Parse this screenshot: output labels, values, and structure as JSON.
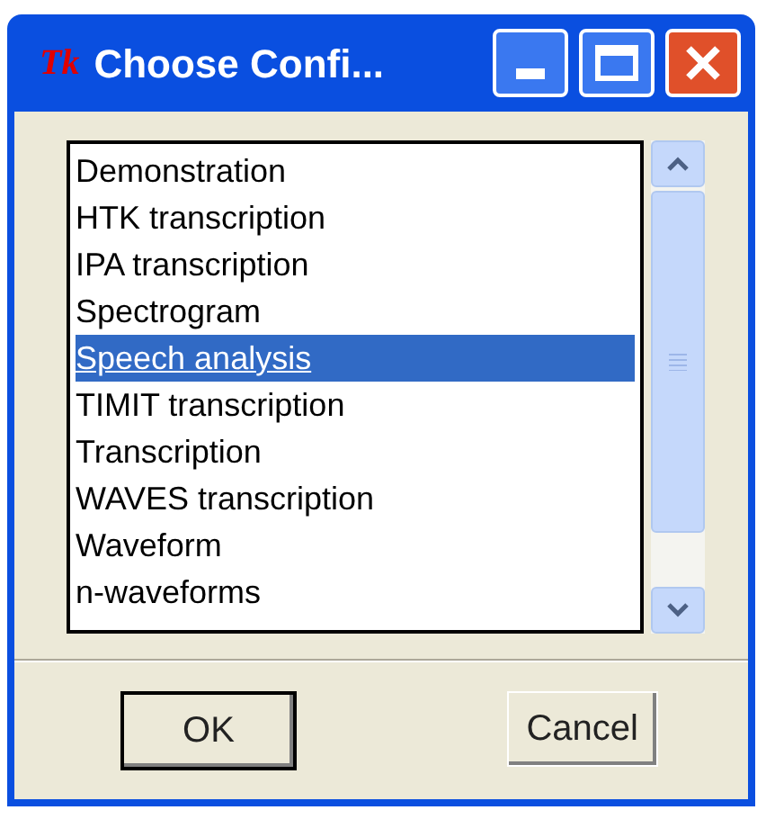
{
  "window": {
    "logo": "Tk",
    "title": "Choose Confi..."
  },
  "list": {
    "items": [
      {
        "label": "Demonstration",
        "selected": false
      },
      {
        "label": "HTK transcription",
        "selected": false
      },
      {
        "label": "IPA transcription",
        "selected": false
      },
      {
        "label": "Spectrogram",
        "selected": false
      },
      {
        "label": "Speech analysis",
        "selected": true
      },
      {
        "label": "TIMIT transcription",
        "selected": false
      },
      {
        "label": "Transcription",
        "selected": false
      },
      {
        "label": "WAVES transcription",
        "selected": false
      },
      {
        "label": "Waveform",
        "selected": false
      },
      {
        "label": "n-waveforms",
        "selected": false
      }
    ]
  },
  "buttons": [
    {
      "label": "OK",
      "default": true
    },
    {
      "label": "Cancel",
      "default": false
    }
  ]
}
